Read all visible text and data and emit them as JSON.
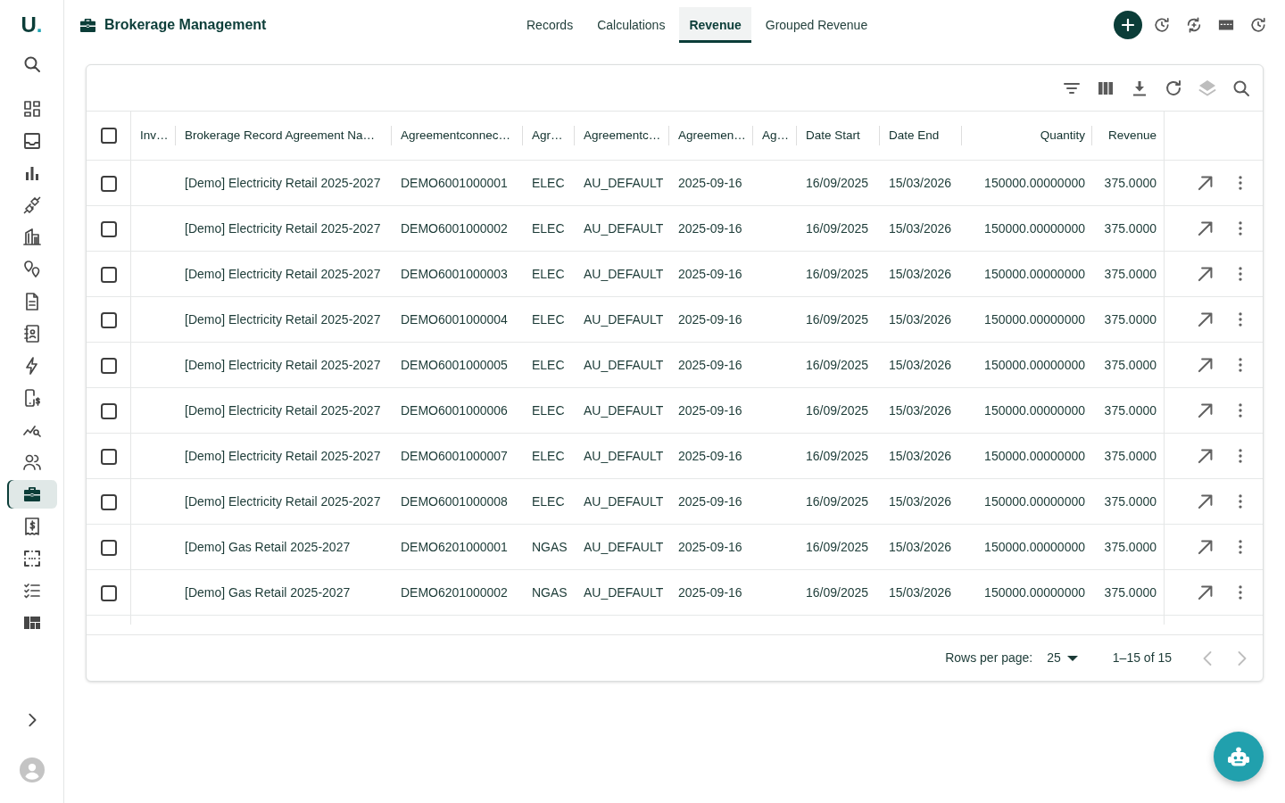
{
  "app": {
    "logo_letter": "U",
    "logo_mark": "."
  },
  "sidebar": {
    "items": [
      {
        "selected": false
      },
      {
        "selected": false
      },
      {
        "selected": false
      },
      {
        "selected": false
      },
      {
        "selected": false
      },
      {
        "selected": false
      },
      {
        "selected": false
      },
      {
        "selected": false
      },
      {
        "selected": false
      },
      {
        "selected": false
      },
      {
        "selected": false
      },
      {
        "selected": false
      },
      {
        "selected": true
      },
      {
        "selected": false
      },
      {
        "selected": false
      },
      {
        "selected": false
      },
      {
        "selected": false
      }
    ]
  },
  "header": {
    "title": "Brokerage Management",
    "tabs": [
      {
        "label": "Records",
        "selected": false
      },
      {
        "label": "Calculations",
        "selected": false
      },
      {
        "label": "Revenue",
        "selected": true
      },
      {
        "label": "Grouped Revenue",
        "selected": false
      }
    ]
  },
  "toolbar": {
    "buttons": [
      {
        "disabled": false
      },
      {
        "disabled": false
      },
      {
        "disabled": false
      },
      {
        "disabled": false
      },
      {
        "disabled": true
      },
      {
        "disabled": false
      }
    ]
  },
  "table": {
    "select_all_checked": false,
    "columns": [
      {
        "label": "Inv…",
        "kind": "text"
      },
      {
        "label": "Brokerage Record Agreement Na…",
        "kind": "text"
      },
      {
        "label": "Agreementconnec…",
        "kind": "text"
      },
      {
        "label": "Agr…",
        "kind": "text"
      },
      {
        "label": "Agreementc…",
        "kind": "text"
      },
      {
        "label": "Agreemen…",
        "kind": "text"
      },
      {
        "label": "Ag…",
        "kind": "text"
      },
      {
        "label": "Date Start",
        "kind": "text"
      },
      {
        "label": "Date End",
        "kind": "text"
      },
      {
        "label": "Quantity",
        "kind": "number"
      },
      {
        "label": "Revenue",
        "kind": "number"
      }
    ],
    "rows": [
      {
        "checked": false,
        "cells": [
          null,
          "[Demo] Electricity Retail 2025-2027",
          "DEMO6001000001",
          "ELEC",
          "AU_DEFAULT",
          "2025-09-16",
          null,
          "16/09/2025",
          "15/03/2026",
          "150000.00000000",
          "375.0000"
        ]
      },
      {
        "checked": false,
        "cells": [
          null,
          "[Demo] Electricity Retail 2025-2027",
          "DEMO6001000002",
          "ELEC",
          "AU_DEFAULT",
          "2025-09-16",
          null,
          "16/09/2025",
          "15/03/2026",
          "150000.00000000",
          "375.0000"
        ]
      },
      {
        "checked": false,
        "cells": [
          null,
          "[Demo] Electricity Retail 2025-2027",
          "DEMO6001000003",
          "ELEC",
          "AU_DEFAULT",
          "2025-09-16",
          null,
          "16/09/2025",
          "15/03/2026",
          "150000.00000000",
          "375.0000"
        ]
      },
      {
        "checked": false,
        "cells": [
          null,
          "[Demo] Electricity Retail 2025-2027",
          "DEMO6001000004",
          "ELEC",
          "AU_DEFAULT",
          "2025-09-16",
          null,
          "16/09/2025",
          "15/03/2026",
          "150000.00000000",
          "375.0000"
        ]
      },
      {
        "checked": false,
        "cells": [
          null,
          "[Demo] Electricity Retail 2025-2027",
          "DEMO6001000005",
          "ELEC",
          "AU_DEFAULT",
          "2025-09-16",
          null,
          "16/09/2025",
          "15/03/2026",
          "150000.00000000",
          "375.0000"
        ]
      },
      {
        "checked": false,
        "cells": [
          null,
          "[Demo] Electricity Retail 2025-2027",
          "DEMO6001000006",
          "ELEC",
          "AU_DEFAULT",
          "2025-09-16",
          null,
          "16/09/2025",
          "15/03/2026",
          "150000.00000000",
          "375.0000"
        ]
      },
      {
        "checked": false,
        "cells": [
          null,
          "[Demo] Electricity Retail 2025-2027",
          "DEMO6001000007",
          "ELEC",
          "AU_DEFAULT",
          "2025-09-16",
          null,
          "16/09/2025",
          "15/03/2026",
          "150000.00000000",
          "375.0000"
        ]
      },
      {
        "checked": false,
        "cells": [
          null,
          "[Demo] Electricity Retail 2025-2027",
          "DEMO6001000008",
          "ELEC",
          "AU_DEFAULT",
          "2025-09-16",
          null,
          "16/09/2025",
          "15/03/2026",
          "150000.00000000",
          "375.0000"
        ]
      },
      {
        "checked": false,
        "cells": [
          null,
          "[Demo] Gas Retail 2025-2027",
          "DEMO6201000001",
          "NGAS",
          "AU_DEFAULT",
          "2025-09-16",
          null,
          "16/09/2025",
          "15/03/2026",
          "150000.00000000",
          "375.0000"
        ]
      },
      {
        "checked": false,
        "cells": [
          null,
          "[Demo] Gas Retail 2025-2027",
          "DEMO6201000002",
          "NGAS",
          "AU_DEFAULT",
          "2025-09-16",
          null,
          "16/09/2025",
          "15/03/2026",
          "150000.00000000",
          "375.0000"
        ]
      }
    ]
  },
  "pagination": {
    "rows_per_page_label": "Rows per page:",
    "rows_per_page": "25",
    "range": "1–15 of 15",
    "previous_disabled": true,
    "next_disabled": true
  }
}
